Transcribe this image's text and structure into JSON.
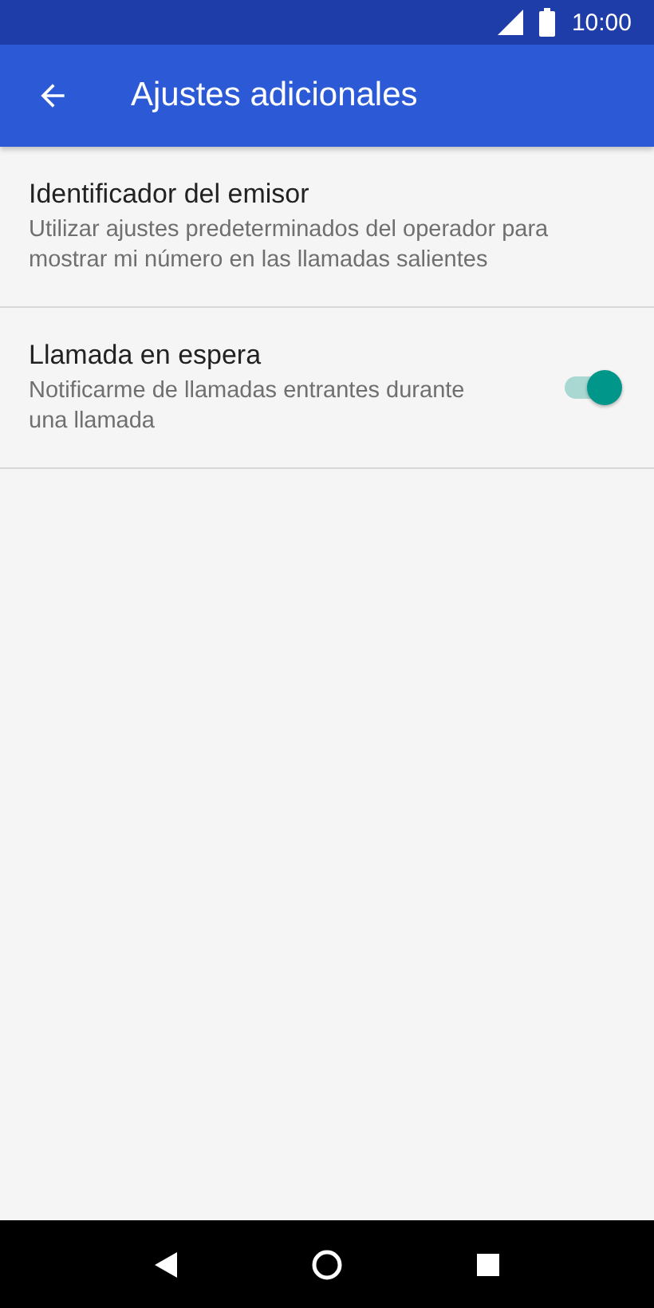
{
  "status_bar": {
    "time": "10:00"
  },
  "app_bar": {
    "title": "Ajustes adicionales"
  },
  "settings": [
    {
      "kind": "text",
      "title": "Identificador del emisor",
      "summary": "Utilizar ajustes predeterminados del operador para mostrar mi número en las llamadas salientes"
    },
    {
      "kind": "switch",
      "title": "Llamada en espera",
      "summary": "Notificarme de llamadas entrantes durante una llamada",
      "on": true
    }
  ]
}
